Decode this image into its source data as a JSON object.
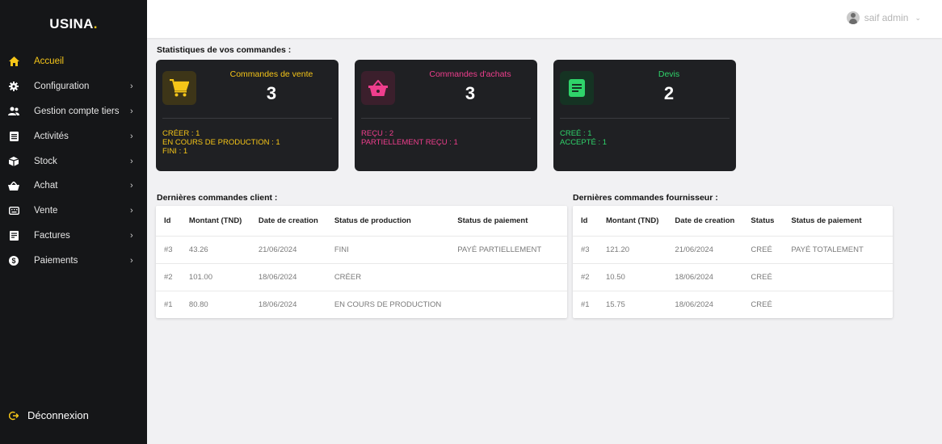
{
  "app": {
    "logo": "USINA",
    "logo_dot": "."
  },
  "sidebar": {
    "items": [
      {
        "label": "Accueil",
        "icon": "home-icon",
        "active": true,
        "has_submenu": false
      },
      {
        "label": "Configuration",
        "icon": "gear-icon",
        "active": false,
        "has_submenu": true
      },
      {
        "label": "Gestion compte tiers",
        "icon": "users-icon",
        "active": false,
        "has_submenu": true
      },
      {
        "label": "Activités",
        "icon": "list-icon",
        "active": false,
        "has_submenu": true
      },
      {
        "label": "Stock",
        "icon": "box-icon",
        "active": false,
        "has_submenu": true
      },
      {
        "label": "Achat",
        "icon": "basket-icon",
        "active": false,
        "has_submenu": true
      },
      {
        "label": "Vente",
        "icon": "keyboard-icon",
        "active": false,
        "has_submenu": true
      },
      {
        "label": "Factures",
        "icon": "receipt-icon",
        "active": false,
        "has_submenu": true
      },
      {
        "label": "Paiements",
        "icon": "dollar-icon",
        "active": false,
        "has_submenu": true
      }
    ],
    "chevron": "›",
    "logout_label": "Déconnexion"
  },
  "header": {
    "user_name": "saif admin",
    "chevron": "⌄"
  },
  "stats": {
    "title": "Statistiques de vos commandes :",
    "cards": [
      {
        "title": "Commandes de vente",
        "count": "3",
        "color": "#f5c518",
        "icon_bg": "#3d3518",
        "icon": "cart-icon",
        "lines": [
          "CRÉER : 1",
          "EN COURS DE PRODUCTION : 1",
          "FINI : 1"
        ]
      },
      {
        "title": "Commandes d'achats",
        "count": "3",
        "color": "#ef3e8d",
        "icon_bg": "#3b1f2c",
        "icon": "basket-icon",
        "lines": [
          "REÇU : 2",
          "PARTIELLEMENT REÇU : 1"
        ]
      },
      {
        "title": "Devis",
        "count": "2",
        "color": "#2fd36a",
        "icon_bg": "#153323",
        "icon": "document-icon",
        "lines": [
          "CREÉ : 1",
          "ACCEPTÉ : 1"
        ]
      }
    ]
  },
  "client_orders": {
    "title": "Dernières commandes client :",
    "headers": [
      "Id",
      "Montant (TND)",
      "Date de creation",
      "Status de production",
      "Status de paiement"
    ],
    "rows": [
      [
        "#3",
        "43.26",
        "21/06/2024",
        "FINI",
        "PAYÉ PARTIELLEMENT"
      ],
      [
        "#2",
        "101.00",
        "18/06/2024",
        "CRÉER",
        ""
      ],
      [
        "#1",
        "80.80",
        "18/06/2024",
        "EN COURS DE PRODUCTION",
        ""
      ]
    ]
  },
  "supplier_orders": {
    "title": "Dernières commandes fournisseur :",
    "headers": [
      "Id",
      "Montant (TND)",
      "Date de creation",
      "Status",
      "Status de paiement"
    ],
    "rows": [
      [
        "#3",
        "121.20",
        "21/06/2024",
        "CREÉ",
        "PAYÉ TOTALEMENT"
      ],
      [
        "#2",
        "10.50",
        "18/06/2024",
        "CREÉ",
        ""
      ],
      [
        "#1",
        "15.75",
        "18/06/2024",
        "CREÉ",
        ""
      ]
    ]
  }
}
